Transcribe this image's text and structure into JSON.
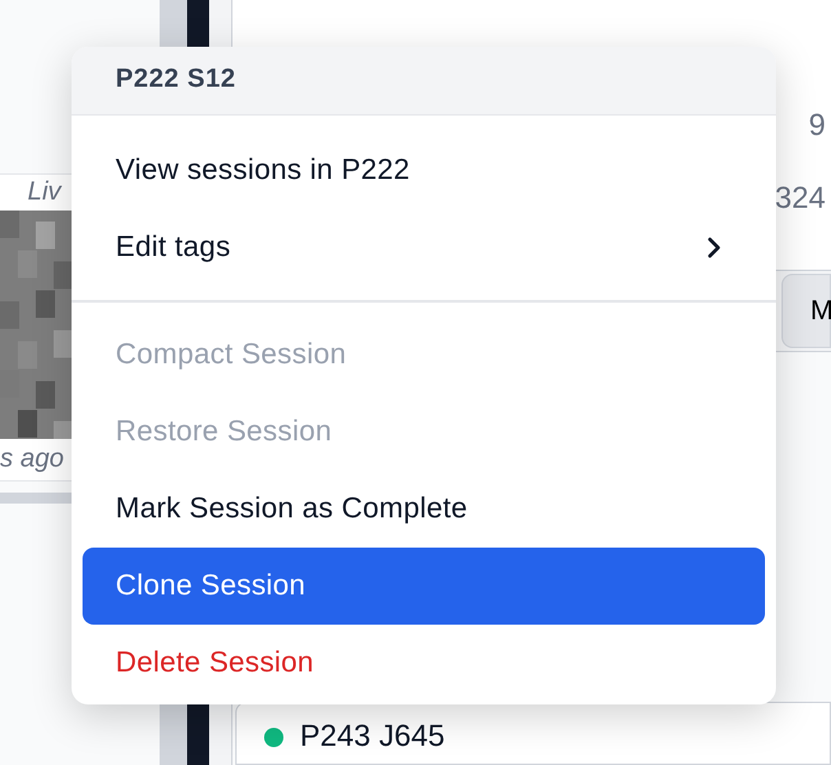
{
  "background": {
    "left_card": {
      "badge": "Liv",
      "time": "s ago"
    },
    "stats": [
      "9",
      "324"
    ],
    "button": "M",
    "session": {
      "name": "P243 J645",
      "color": "#10b981"
    }
  },
  "menu": {
    "title": "P222 S12",
    "sections": [
      [
        {
          "label": "View sessions in P222",
          "kind": "action",
          "disabled": false,
          "selected": false
        },
        {
          "label": "Edit tags",
          "kind": "submenu",
          "disabled": false,
          "selected": false
        }
      ],
      [
        {
          "label": "Compact Session",
          "kind": "action",
          "disabled": true,
          "selected": false
        },
        {
          "label": "Restore Session",
          "kind": "action",
          "disabled": true,
          "selected": false
        },
        {
          "label": "Mark Session as Complete",
          "kind": "action",
          "disabled": false,
          "selected": false
        },
        {
          "label": "Clone Session",
          "kind": "action",
          "disabled": false,
          "selected": true
        },
        {
          "label": "Delete Session",
          "kind": "danger",
          "disabled": false,
          "selected": false
        }
      ]
    ]
  }
}
